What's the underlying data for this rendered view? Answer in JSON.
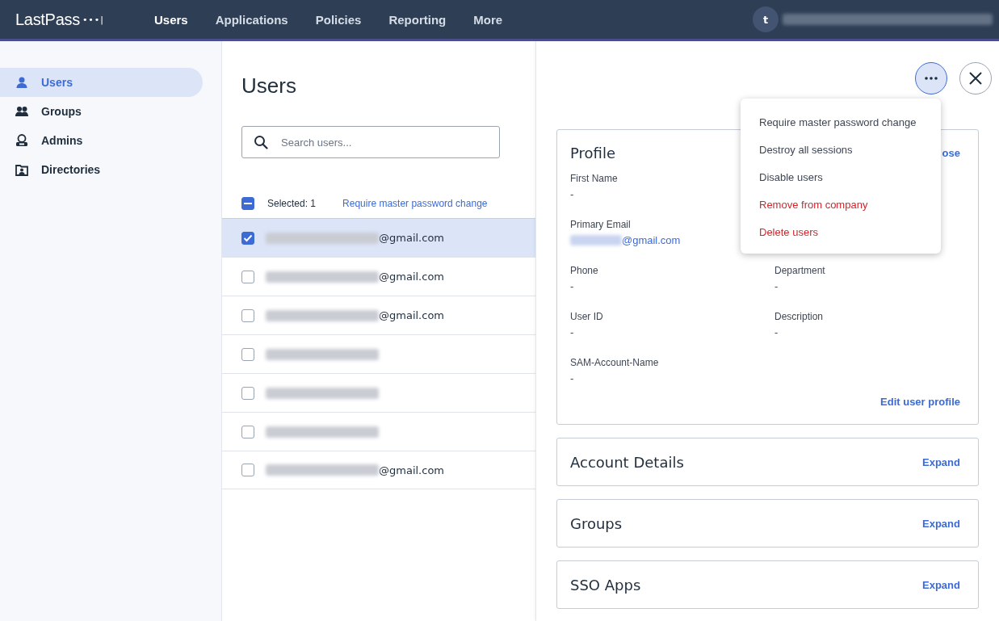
{
  "header": {
    "logo": "LastPass",
    "logo_dots": "•••|",
    "nav": [
      {
        "label": "Users",
        "selected": true
      },
      {
        "label": "Applications",
        "selected": false
      },
      {
        "label": "Policies",
        "selected": false
      },
      {
        "label": "Reporting",
        "selected": false
      },
      {
        "label": "More",
        "selected": false
      }
    ],
    "avatar": "t"
  },
  "sidebar": {
    "items": [
      {
        "label": "Users",
        "kind": "user",
        "selected": true
      },
      {
        "label": "Groups",
        "kind": "group",
        "selected": false
      },
      {
        "label": "Admins",
        "kind": "admin",
        "selected": false
      },
      {
        "label": "Directories",
        "kind": "directory",
        "selected": false
      }
    ]
  },
  "users": {
    "title": "Users",
    "search": {
      "placeholder": "Search users..."
    },
    "selection": {
      "indeterminate": true,
      "count": "Selected: 1",
      "action": "Require master password change"
    },
    "rows": [
      {
        "suffix": "@gmail.com",
        "selected": true
      },
      {
        "suffix": "@gmail.com",
        "selected": false
      },
      {
        "suffix": "@gmail.com",
        "selected": false
      },
      {
        "suffix": "",
        "selected": false
      },
      {
        "suffix": "",
        "selected": false
      },
      {
        "suffix": "",
        "selected": false
      },
      {
        "suffix": "@gmail.com",
        "selected": false
      }
    ]
  },
  "detail": {
    "profile": {
      "title": "Profile",
      "action": "ose",
      "rows": [
        {
          "left": {
            "label": "First Name",
            "value": "-"
          }
        },
        {
          "left": {
            "label": "Primary Email",
            "email_suffix": "@gmail.com"
          }
        },
        {
          "left": {
            "label": "Phone",
            "value": "-"
          },
          "right": {
            "label": "Department",
            "value": "-"
          }
        },
        {
          "left": {
            "label": "User ID",
            "value": "-"
          },
          "right": {
            "label": "Description",
            "value": "-"
          }
        },
        {
          "left": {
            "label": "SAM-Account-Name",
            "value": "-"
          }
        }
      ],
      "edit": "Edit user profile"
    },
    "sections": [
      {
        "title": "Account Details",
        "action": "Expand"
      },
      {
        "title": "Groups",
        "action": "Expand"
      },
      {
        "title": "SSO Apps",
        "action": "Expand"
      }
    ],
    "menu": [
      {
        "label": "Require master password change",
        "kind": "normal"
      },
      {
        "label": "Destroy all sessions",
        "kind": "normal"
      },
      {
        "label": "Disable users",
        "kind": "normal"
      },
      {
        "label": "Remove from company",
        "kind": "danger"
      },
      {
        "label": "Delete users",
        "kind": "danger"
      }
    ]
  }
}
